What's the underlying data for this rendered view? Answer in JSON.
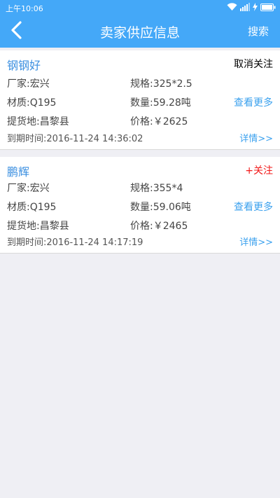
{
  "status_bar": {
    "time": "上午10:06",
    "icons": [
      "wifi-icon",
      "signal-icon",
      "charging-bolt-icon",
      "battery-icon"
    ]
  },
  "header": {
    "back_icon": "chevron-left-icon",
    "title": "卖家供应信息",
    "search_label": "搜索"
  },
  "colors": {
    "header_bg": "#44a8f8",
    "link_blue": "#3ba1ee",
    "follow_red": "#f21818",
    "page_bg": "#efeff4"
  },
  "listings": [
    {
      "seller": "钢钢好",
      "follow_label": "取消关注",
      "manufacturer": "厂家:宏兴",
      "spec": "规格:325*2.5",
      "material": "材质:Q195",
      "quantity": "数量:59.28吨",
      "more_label": "查看更多",
      "pickup": "提货地:昌黎县",
      "price": "价格:￥2625",
      "expire": "到期时间:2016-11-24 14:36:02",
      "detail_label": "详情>>"
    },
    {
      "seller": "鹏辉",
      "follow_label": "+关注",
      "manufacturer": "厂家:宏兴",
      "spec": "规格:355*4",
      "material": "材质:Q195",
      "quantity": "数量:59.06吨",
      "more_label": "查看更多",
      "pickup": "提货地:昌黎县",
      "price": "价格:￥2465",
      "expire": "到期时间:2016-11-24 14:17:19",
      "detail_label": "详情>>"
    }
  ]
}
